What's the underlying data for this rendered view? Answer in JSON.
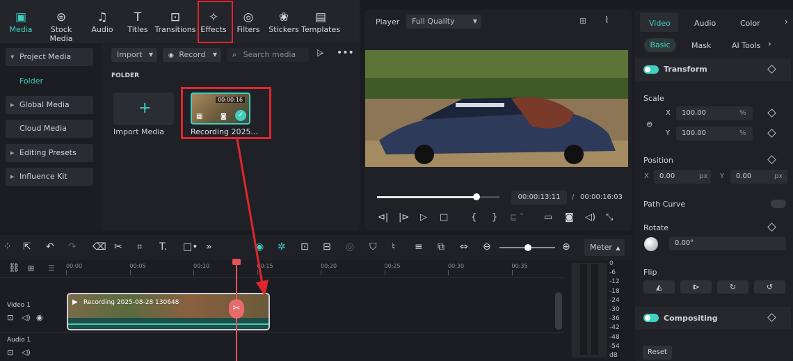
{
  "toolbar": {
    "items": [
      {
        "label": "Media",
        "icon": "media-icon"
      },
      {
        "label": "Stock Media",
        "icon": "stock-media-icon"
      },
      {
        "label": "Audio",
        "icon": "music-note-icon"
      },
      {
        "label": "Titles",
        "icon": "titles-icon"
      },
      {
        "label": "Transitions",
        "icon": "transitions-icon"
      },
      {
        "label": "Effects",
        "icon": "effects-icon"
      },
      {
        "label": "Filters",
        "icon": "filters-icon"
      },
      {
        "label": "Stickers",
        "icon": "stickers-icon"
      },
      {
        "label": "Templates",
        "icon": "templates-icon"
      }
    ]
  },
  "sidebar": {
    "project_media": "Project Media",
    "folder": "Folder",
    "global_media": "Global Media",
    "cloud_media": "Cloud Media",
    "editing_presets": "Editing Presets",
    "influence_kit": "Influence Kit"
  },
  "media": {
    "import_label": "Import",
    "record_label": "Record",
    "search_placeholder": "Search media",
    "folder_header": "FOLDER",
    "import_media_label": "Import Media",
    "clip_duration": "00:00:16",
    "clip_name": "Recording 2025..."
  },
  "player": {
    "label": "Player",
    "quality": "Full Quality",
    "current_time": "00:00:13:11",
    "separator": "/",
    "total_time": "00:00:16:03",
    "progress": 0.81
  },
  "timeline": {
    "meter_label": "Meter",
    "ruler": [
      "00:00",
      "00:05",
      "00:10",
      "00:15",
      "00:20",
      "00:25",
      "00:30",
      "00:35"
    ],
    "meter_scale": [
      "0",
      "-6",
      "-12",
      "-18",
      "-24",
      "-30",
      "-36",
      "-42",
      "-48",
      "-54",
      "dB"
    ],
    "video_track": "Video 1",
    "audio_track": "Audio 1",
    "clip_title": "Recording 2025-08-28 130648"
  },
  "properties": {
    "tabs": [
      "Video",
      "Audio",
      "Color"
    ],
    "subtabs": [
      "Basic",
      "Mask",
      "AI Tools"
    ],
    "transform": "Transform",
    "scale": "Scale",
    "x_label": "X",
    "y_label": "Y",
    "scale_x": "100.00",
    "scale_y": "100.00",
    "percent": "%",
    "position": "Position",
    "pos_x": "0.00",
    "pos_y": "0.00",
    "px": "px",
    "path_curve": "Path Curve",
    "rotate": "Rotate",
    "rotate_value": "0.00°",
    "flip": "Flip",
    "compositing": "Compositing",
    "reset": "Reset"
  },
  "colors": {
    "accent": "#3fd0c0",
    "highlight": "#e0262d",
    "playhead": "#e05555"
  }
}
